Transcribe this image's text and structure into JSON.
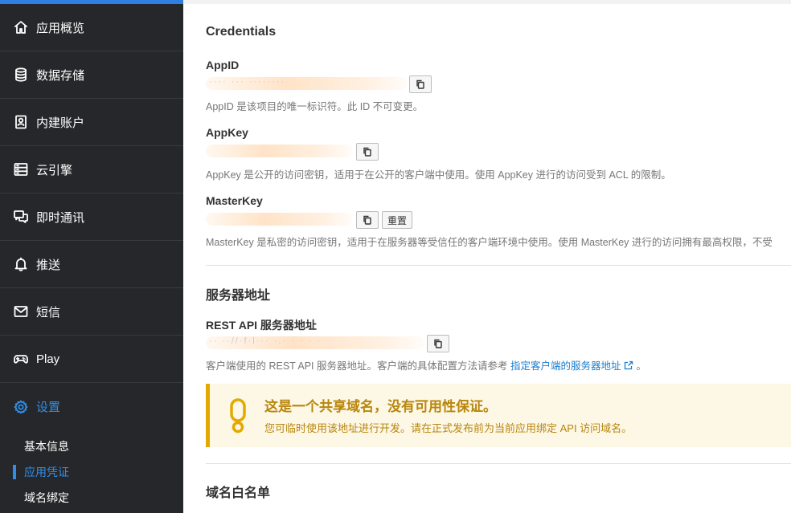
{
  "sidebar": {
    "items": [
      {
        "label": "应用概览",
        "icon": "home-icon"
      },
      {
        "label": "数据存储",
        "icon": "database-icon"
      },
      {
        "label": "内建账户",
        "icon": "user-card-icon"
      },
      {
        "label": "云引擎",
        "icon": "server-icon"
      },
      {
        "label": "即时通讯",
        "icon": "chat-icon"
      },
      {
        "label": "推送",
        "icon": "bell-icon"
      },
      {
        "label": "短信",
        "icon": "mail-icon"
      },
      {
        "label": "Play",
        "icon": "gamepad-icon"
      },
      {
        "label": "设置",
        "icon": "gear-icon"
      }
    ],
    "sub_items": [
      {
        "label": "基本信息"
      },
      {
        "label": "应用凭证"
      },
      {
        "label": "域名绑定"
      }
    ],
    "accent_color": "#2f8fe8"
  },
  "credentials": {
    "title": "Credentials",
    "appid": {
      "label": "AppID",
      "value_masked": "···· ··· ········",
      "help": "AppID 是该项目的唯一标识符。此 ID 不可变更。"
    },
    "appkey": {
      "label": "AppKey",
      "value_masked": "",
      "help": "AppKey 是公开的访问密钥，适用于在公开的客户端中使用。使用 AppKey 进行的访问受到 ACL 的限制。"
    },
    "masterkey": {
      "label": "MasterKey",
      "value_masked": "",
      "reset_label": "重置",
      "help": "MasterKey 是私密的访问密钥，适用于在服务器等受信任的客户端环境中使用。使用 MasterKey 进行的访问拥有最高权限，不受"
    }
  },
  "server": {
    "title": "服务器地址",
    "rest_label": "REST API 服务器地址",
    "rest_value_masked": "·· ··//·f·l··· ·.· ·  ·   ·  ·",
    "help_prefix": "客户端使用的 REST API 服务器地址。客户端的具体配置方法请参考",
    "help_link": "指定客户端的服务器地址",
    "help_suffix": "。"
  },
  "warning": {
    "title": "这是一个共享域名，没有可用性保证。",
    "text": "您可临时使用该地址进行开发。请在正式发布前为当前应用绑定 API 访问域名。",
    "color": "#b8860b"
  },
  "whitelist": {
    "title": "域名白名单"
  }
}
